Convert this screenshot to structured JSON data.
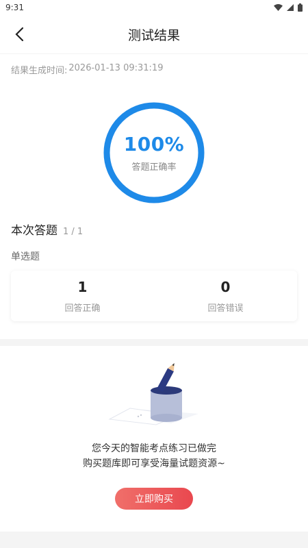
{
  "status_bar": {
    "time": "9:31",
    "icons": [
      "wifi-icon",
      "signal-icon",
      "battery-icon"
    ]
  },
  "header": {
    "title": "测试结果",
    "back_icon": "chevron-left-icon"
  },
  "result": {
    "generated_label": "结果生成时间:",
    "generated_time": "2026-01-13 09:31:19",
    "percent": "100%",
    "percent_value": 1.0,
    "percent_label": "答题正确率"
  },
  "section": {
    "title": "本次答题",
    "count": "1 / 1",
    "question_type": "单选题"
  },
  "stats": [
    {
      "value": "1",
      "label": "回答正确"
    },
    {
      "value": "0",
      "label": "回答错误"
    }
  ],
  "promo": {
    "line1": "您今天的智能考点练习已做完",
    "line2": "购买题库即可享受海量试题资源~",
    "button": "立即购买"
  },
  "colors": {
    "accent": "#1e8ae8",
    "button": "#ec5356"
  }
}
